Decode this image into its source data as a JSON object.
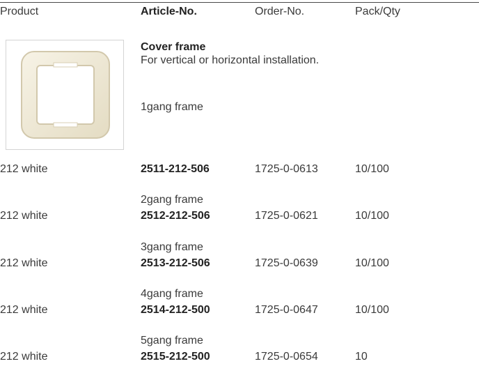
{
  "header": {
    "product": "Product",
    "article": "Article-No.",
    "order": "Order-No.",
    "pack": "Pack/Qty"
  },
  "intro": {
    "title": "Cover frame",
    "description": "For vertical or horizontal installation.",
    "first_group": "1gang frame"
  },
  "rows": [
    {
      "group": "",
      "product": "212  white",
      "article": "2511-212-506",
      "order": "1725-0-0613",
      "pack": "10/100"
    },
    {
      "group": "2gang frame",
      "product": "212  white",
      "article": "2512-212-506",
      "order": "1725-0-0621",
      "pack": "10/100"
    },
    {
      "group": "3gang frame",
      "product": "212  white",
      "article": "2513-212-506",
      "order": "1725-0-0639",
      "pack": "10/100"
    },
    {
      "group": "4gang frame",
      "product": "212  white",
      "article": "2514-212-500",
      "order": "1725-0-0647",
      "pack": "10/100"
    },
    {
      "group": "5gang frame",
      "product": "212  white",
      "article": "2515-212-500",
      "order": "1725-0-0654",
      "pack": "10"
    }
  ],
  "colors": {
    "frame": "#efe9d8",
    "frame_edge": "#d8d0b8",
    "text": "#3a3a3a"
  }
}
